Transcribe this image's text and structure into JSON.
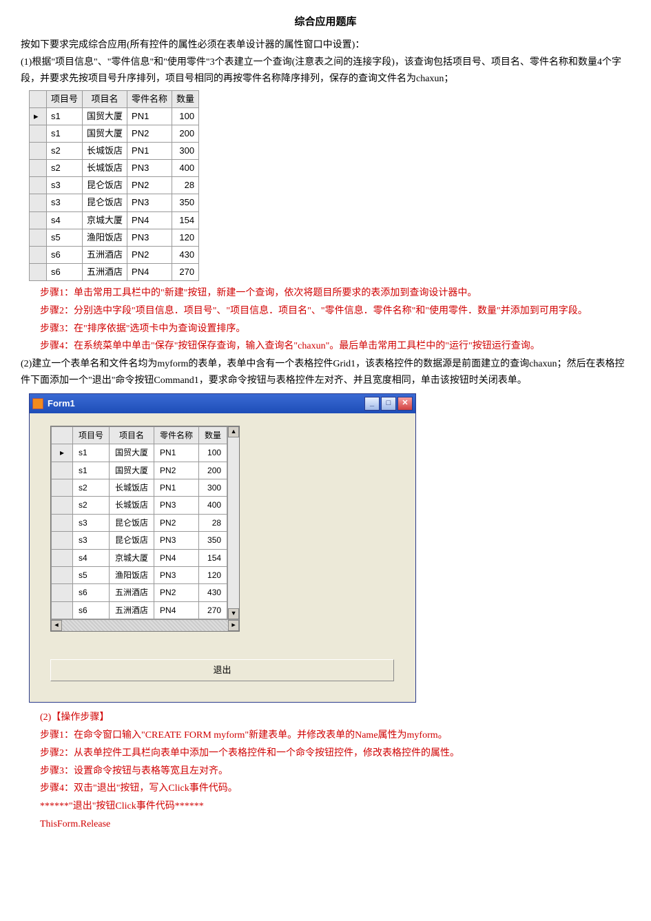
{
  "title": "综合应用题库",
  "intro": "按如下要求完成综合应用(所有控件的属性必须在表单设计器的属性窗口中设置)：",
  "q1": "(1)根据\"项目信息\"、\"零件信息\"和\"使用零件\"3个表建立一个查询(注意表之间的连接字段)，该查询包括项目号、项目名、零件名称和数量4个字段，并要求先按项目号升序排列，项目号相同的再按零件名称降序排列，保存的查询文件名为chaxun；",
  "table1": {
    "headers": [
      "项目号",
      "项目名",
      "零件名称",
      "数量"
    ],
    "rows": [
      [
        "s1",
        "国贸大厦",
        "PN1",
        "100"
      ],
      [
        "s1",
        "国贸大厦",
        "PN2",
        "200"
      ],
      [
        "s2",
        "长城饭店",
        "PN1",
        "300"
      ],
      [
        "s2",
        "长城饭店",
        "PN3",
        "400"
      ],
      [
        "s3",
        "昆仑饭店",
        "PN2",
        "28"
      ],
      [
        "s3",
        "昆仑饭店",
        "PN3",
        "350"
      ],
      [
        "s4",
        "京城大厦",
        "PN4",
        "154"
      ],
      [
        "s5",
        "渔阳饭店",
        "PN3",
        "120"
      ],
      [
        "s6",
        "五洲酒店",
        "PN2",
        "430"
      ],
      [
        "s6",
        "五洲酒店",
        "PN4",
        "270"
      ]
    ]
  },
  "steps1": {
    "s1": "步骤1：单击常用工具栏中的\"新建\"按钮，新建一个查询，依次将题目所要求的表添加到查询设计器中。",
    "s2a": "步骤2：分别选中字段\"项目信息．项目号\"、\"项目信息．项目名\"、\"零件信息．零件名称\"和\"使用零件．数量\"并添加到可用字段。",
    "s3": "步骤3：在\"排序依据\"选项卡中为查询设置排序。",
    "s4": "步骤4：在系统菜单中单击\"保存\"按钮保存查询，输入查询名\"chaxun\"。最后单击常用工具栏中的\"运行\"按钮运行查询。"
  },
  "q2": "(2)建立一个表单名和文件名均为myform的表单，表单中含有一个表格控件Grid1，该表格控件的数据源是前面建立的查询chaxun；然后在表格控件下面添加一个\"退出\"命令按钮Command1，要求命令按钮与表格控件左对齐、并且宽度相同，单击该按钮时关闭表单。",
  "form1": {
    "title": "Form1",
    "exit_label": "退出",
    "grid": {
      "headers": [
        "项目号",
        "项目名",
        "零件名称",
        "数量"
      ],
      "rows": [
        [
          "s1",
          "国贸大厦",
          "PN1",
          "100"
        ],
        [
          "s1",
          "国贸大厦",
          "PN2",
          "200"
        ],
        [
          "s2",
          "长城饭店",
          "PN1",
          "300"
        ],
        [
          "s2",
          "长城饭店",
          "PN3",
          "400"
        ],
        [
          "s3",
          "昆仑饭店",
          "PN2",
          "28"
        ],
        [
          "s3",
          "昆仑饭店",
          "PN3",
          "350"
        ],
        [
          "s4",
          "京城大厦",
          "PN4",
          "154"
        ],
        [
          "s5",
          "渔阳饭店",
          "PN3",
          "120"
        ],
        [
          "s6",
          "五洲酒店",
          "PN2",
          "430"
        ],
        [
          "s6",
          "五洲酒店",
          "PN4",
          "270"
        ]
      ]
    }
  },
  "steps2": {
    "hdr": "(2)【操作步骤】",
    "s1": "步骤1：在命令窗口输入\"CREATE  FORM  myform\"新建表单。并修改表单的Name属性为myform。",
    "s2": "步骤2：从表单控件工具栏向表单中添加一个表格控件和一个命令按钮控件，修改表格控件的属性。",
    "s3": "步骤3：设置命令按钮与表格等宽且左对齐。",
    "s4": "步骤4：双击\"退出\"按钮，写入Click事件代码。",
    "code_hdr": "******\"退出\"按钮Click事件代码******",
    "code": "ThisForm.Release"
  }
}
